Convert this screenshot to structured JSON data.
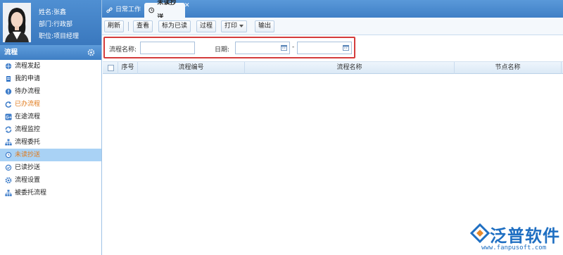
{
  "profile": {
    "name": "姓名:张鑫",
    "department": "部门:行政部",
    "position": "职位:项目经理"
  },
  "sidebar": {
    "title": "流程",
    "items": [
      {
        "label": "流程发起",
        "icon": "globe-icon"
      },
      {
        "label": "我的申请",
        "icon": "document-icon"
      },
      {
        "label": "待办流程",
        "icon": "alert-circle-icon"
      },
      {
        "label": "已办流程",
        "icon": "refresh-icon"
      },
      {
        "label": "在途流程",
        "icon": "google-plus-icon"
      },
      {
        "label": "流程监控",
        "icon": "sync-icon"
      },
      {
        "label": "流程委托",
        "icon": "sitemap-icon"
      },
      {
        "label": "未读抄送",
        "icon": "clock-icon"
      },
      {
        "label": "已读抄送",
        "icon": "check-circle-icon"
      },
      {
        "label": "流程设置",
        "icon": "cog-icon"
      },
      {
        "label": "被委托流程",
        "icon": "sitemap-icon"
      }
    ]
  },
  "tabs": [
    {
      "label": "日常工作",
      "icon": "link-icon"
    },
    {
      "label": "未读抄送",
      "icon": "clock-icon"
    }
  ],
  "toolbar": {
    "refresh": "刷新",
    "view": "查看",
    "mark_read": "标为已读",
    "process": "过程",
    "print": "打印",
    "export": "输出"
  },
  "search": {
    "name_label": "流程名称:",
    "name_value": "",
    "date_label": "日期:",
    "date_from": "",
    "date_to": "",
    "date_sep": "-"
  },
  "table": {
    "columns": [
      "序号",
      "流程编号",
      "流程名称",
      "节点名称"
    ]
  },
  "brand": {
    "name": "泛普软件",
    "url": "www.fanpusoft.com",
    "color": "#1f6fc2"
  },
  "colors": {
    "header_blue": "#4a8bd0",
    "active_item": "#a9d2f5",
    "highlight_border": "#d43c3c",
    "orange_text": "#e07a1b"
  }
}
